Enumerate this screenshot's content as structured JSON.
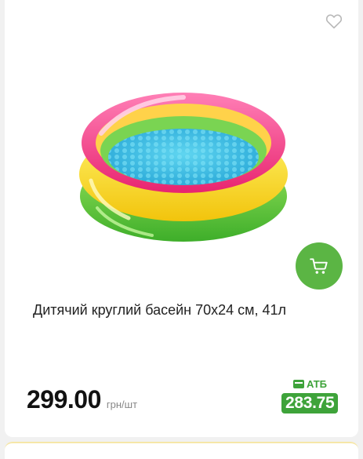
{
  "product": {
    "title": "Дитячий круглий басейн 70х24 см, 41л",
    "price": "299.00",
    "unit": "грн/шт",
    "atb_label": "АТБ",
    "atb_price": "283.75",
    "image_alt": "Children's inflatable pool"
  },
  "icons": {
    "favorite": "heart-outline-icon",
    "cart": "shopping-cart-icon",
    "atb": "card-icon"
  },
  "colors": {
    "accent_green": "#5bb544",
    "atb_green": "#3ea33a"
  }
}
